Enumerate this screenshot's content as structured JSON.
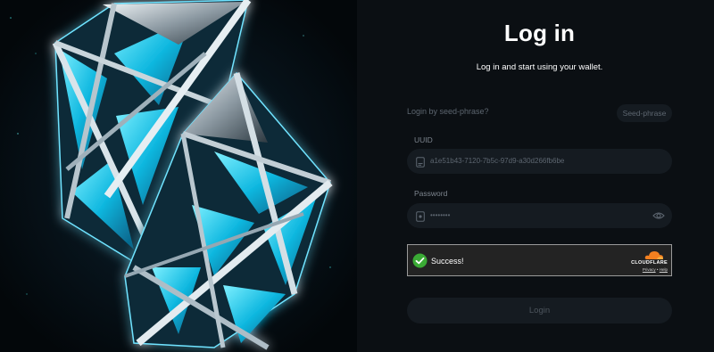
{
  "page": {
    "title": "Log in",
    "subtitle": "Log in and start using your wallet."
  },
  "seed": {
    "prompt": "Login by seed-phrase?",
    "button_label": "Seed-phrase"
  },
  "uuid_field": {
    "label": "UUID",
    "value": "a1e51b43-7120-7b5c-97d9-a30d266fb6be"
  },
  "password_field": {
    "label": "Password",
    "value": "••••••••"
  },
  "captcha": {
    "status": "Success!",
    "brand": "CLOUDFLARE",
    "privacy_link": "Privacy",
    "separator": "•",
    "help_link": "Help"
  },
  "login_button": {
    "label": "Login"
  },
  "colors": {
    "background": "#0b0f13",
    "input_bg": "#151b21",
    "success_green": "#3aaa35",
    "cloudflare_orange": "#f38020",
    "crystal_glow": "#22d3ee"
  },
  "icons": [
    "crystal-hero-image",
    "id-card-icon",
    "lock-icon",
    "eye-icon",
    "checkmark-icon",
    "cloudflare-cloud-icon"
  ]
}
